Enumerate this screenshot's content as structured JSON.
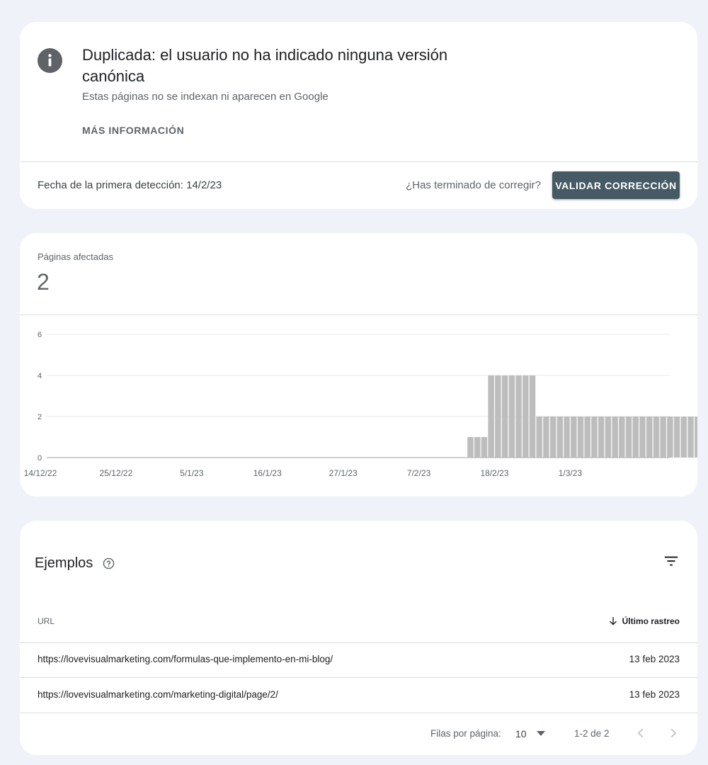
{
  "issue": {
    "title": "Duplicada: el usuario no ha indicado ninguna versión canónica",
    "subtitle": "Estas páginas no se indexan ni aparecen en Google",
    "more_info": "MÁS INFORMACIÓN",
    "first_detected": "Fecha de la primera detección: 14/2/23",
    "finished_question": "¿Has terminado de corregir?",
    "validate_button": "VALIDAR CORRECCIÓN"
  },
  "summary": {
    "label": "Páginas afectadas",
    "count": "2"
  },
  "chart_data": {
    "type": "bar",
    "x_tick_labels": [
      "14/12/22",
      "25/12/22",
      "5/1/23",
      "16/1/23",
      "27/1/23",
      "7/2/23",
      "18/2/23",
      "1/3/23"
    ],
    "y_ticks": [
      0,
      2,
      4,
      6
    ],
    "ylim": [
      0,
      6
    ],
    "start_date": "2022-12-14",
    "num_days": 96,
    "series": [
      {
        "values": [
          0,
          0,
          0,
          0,
          0,
          0,
          0,
          0,
          0,
          0,
          0,
          0,
          0,
          0,
          0,
          0,
          0,
          0,
          0,
          0,
          0,
          0,
          0,
          0,
          0,
          0,
          0,
          0,
          0,
          0,
          0,
          0,
          0,
          0,
          0,
          0,
          0,
          0,
          0,
          0,
          0,
          0,
          0,
          0,
          0,
          0,
          0,
          0,
          0,
          0,
          0,
          0,
          0,
          0,
          0,
          0,
          0,
          0,
          0,
          0,
          0,
          0,
          1,
          1,
          1,
          4,
          4,
          4,
          4,
          4,
          4,
          4,
          2,
          2,
          2,
          2,
          2,
          2,
          2,
          2,
          2,
          2,
          2,
          2,
          2,
          2,
          2,
          2,
          2,
          2,
          2,
          2,
          2,
          2,
          2,
          2
        ]
      }
    ],
    "bar_color": "#bdbdbd",
    "grid": true
  },
  "examples": {
    "title": "Ejemplos",
    "columns": {
      "url": "URL",
      "last_crawl": "Último rastreo"
    },
    "rows": [
      {
        "url": "https://lovevisualmarketing.com/formulas-que-implemento-en-mi-blog/",
        "date": "13 feb 2023"
      },
      {
        "url": "https://lovevisualmarketing.com/marketing-digital/page/2/",
        "date": "13 feb 2023"
      }
    ],
    "pagination": {
      "rows_label": "Filas por página:",
      "rows_value": "10",
      "range": "1-2 de 2"
    }
  }
}
